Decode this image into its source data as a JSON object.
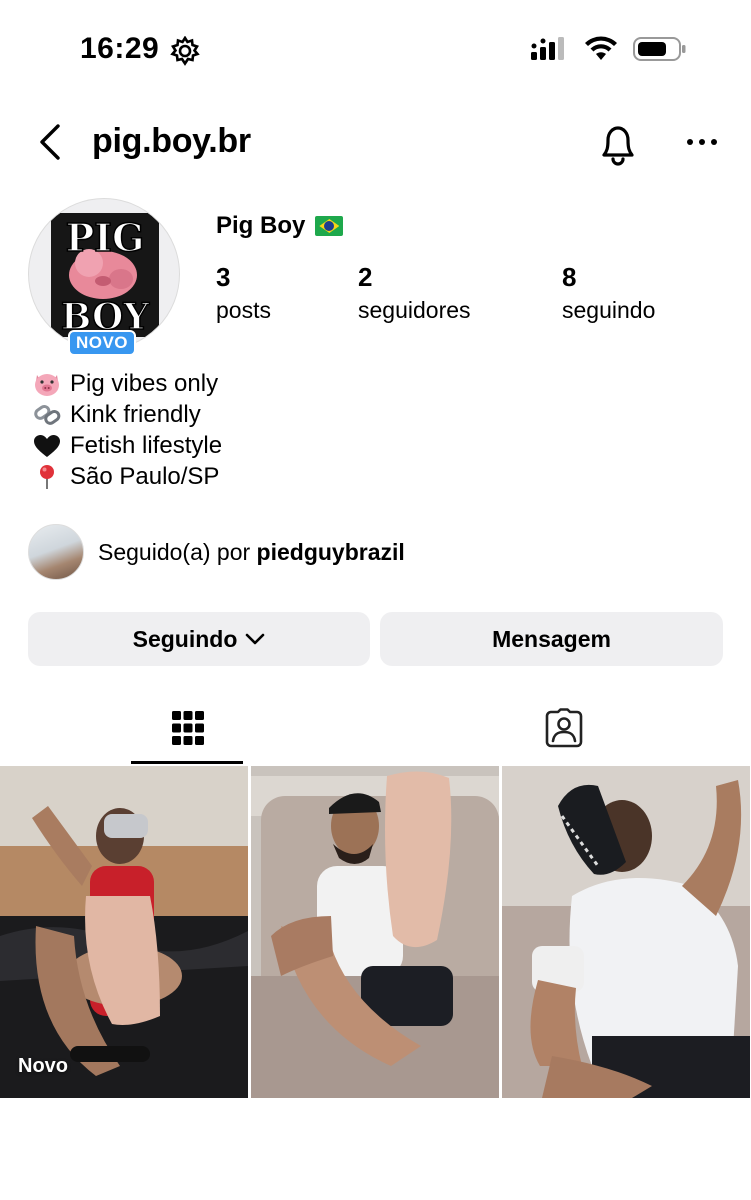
{
  "status_bar": {
    "time": "16:29"
  },
  "nav": {
    "username": "pig.boy.br"
  },
  "profile": {
    "avatar_text_top": "PIG",
    "avatar_text_bottom": "BOY",
    "badge": "NOVO",
    "display_name": "Pig Boy",
    "stats": [
      {
        "num": "3",
        "label": "posts"
      },
      {
        "num": "2",
        "label": "seguidores"
      },
      {
        "num": "8",
        "label": "seguindo"
      }
    ],
    "bio": [
      {
        "icon": "pig-face-emoji",
        "text": "Pig vibes only"
      },
      {
        "icon": "chain-link-emoji",
        "text": "Kink friendly"
      },
      {
        "icon": "black-heart-emoji",
        "text": "Fetish lifestyle"
      },
      {
        "icon": "round-pushpin-emoji",
        "text": "São Paulo/SP"
      }
    ],
    "followed_by_prefix": "Seguido(a) por ",
    "followed_by_user": "piedguybrazil"
  },
  "actions": {
    "following_label": "Seguindo",
    "message_label": "Mensagem"
  },
  "tabs": [
    {
      "icon": "grid-icon",
      "active": true
    },
    {
      "icon": "tagged-person-icon",
      "active": false
    }
  ],
  "grid": [
    {
      "label": "Novo"
    },
    {
      "label": ""
    },
    {
      "label": ""
    }
  ],
  "colors": {
    "badge_blue": "#3897f0",
    "button_bg": "#efeff1"
  }
}
